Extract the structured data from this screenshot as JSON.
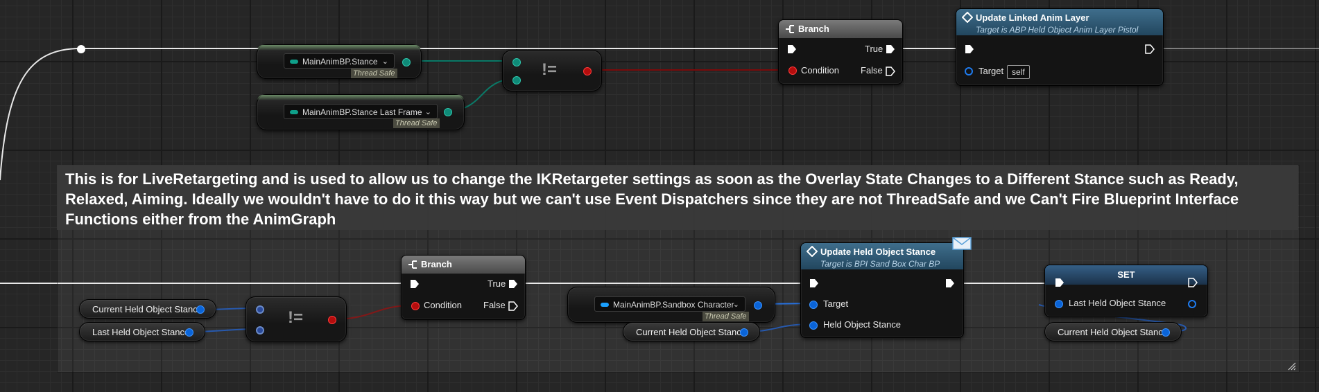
{
  "comment": {
    "text": "This is for LiveRetargeting and is used to allow us to change the IKRetargeter settings as soon as the Overlay State Changes to a Different Stance such as Ready, Relaxed, Aiming. Ideally we wouldn't have to do it this way but we can't use Event Dispatchers since they are not ThreadSafe and we Can't Fire Blueprint Interface Functions either from the AnimGraph"
  },
  "top_row": {
    "stance_getter": {
      "label": "MainAnimBP.Stance",
      "badge": "Thread Safe"
    },
    "stance_last_frame_getter": {
      "label": "MainAnimBP.Stance Last Frame",
      "badge": "Thread Safe"
    },
    "not_equal": {
      "symbol": "!="
    },
    "branch": {
      "title": "Branch",
      "true_label": "True",
      "false_label": "False",
      "condition_label": "Condition"
    },
    "update_linked_anim_layer": {
      "title": "Update Linked Anim Layer",
      "subtitle": "Target is ABP Held Object Anim Layer Pistol",
      "target_label": "Target",
      "target_value": "self"
    }
  },
  "bottom_row": {
    "current_held_object_stance_var": "Current Held Object Stance",
    "last_held_object_stance_var": "Last Held Object Stance",
    "not_equal": {
      "symbol": "!="
    },
    "branch": {
      "title": "Branch",
      "true_label": "True",
      "false_label": "False",
      "condition_label": "Condition"
    },
    "sandbox_character_getter": {
      "label": "MainAnimBP.Sandbox Character",
      "badge": "Thread Safe"
    },
    "current_held_object_stance_var_2": "Current Held Object Stance",
    "update_held_object_stance": {
      "title": "Update Held Object Stance",
      "subtitle": "Target is BPI Sand Box Char BP",
      "target_label": "Target",
      "held_object_stance_label": "Held Object Stance"
    },
    "set_node": {
      "title": "SET",
      "pin_label": "Last Held Object Stance"
    },
    "current_held_object_stance_var_3": "Current Held Object Stance"
  },
  "colors": {
    "exec_wire": "#ffffff",
    "bool_wire": "#8a0a0a",
    "enum_wire": "#0a6e60",
    "byte_wire": "#1a4fa8",
    "function_header": "#2f5a78",
    "branch_header": "#5a5a5a"
  }
}
